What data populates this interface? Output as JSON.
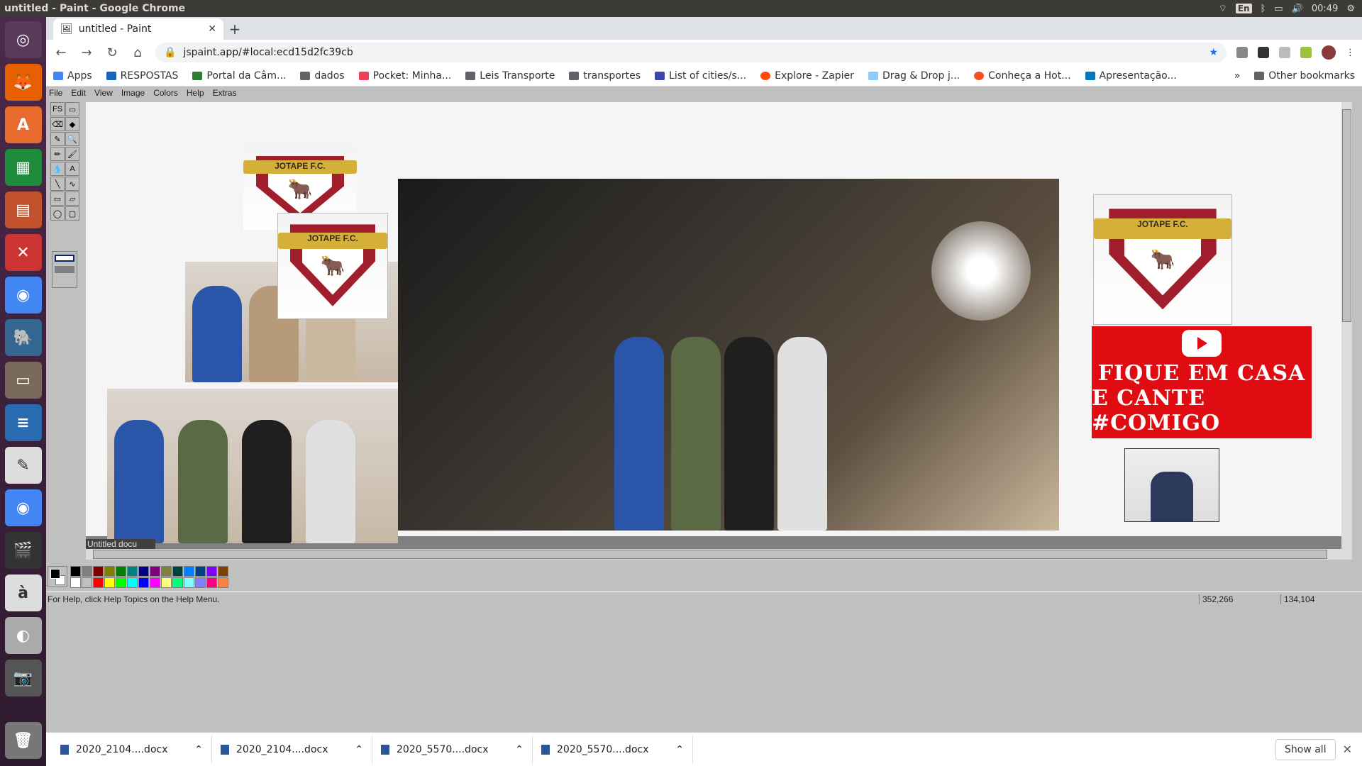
{
  "system": {
    "window_title": "untitled - Paint - Google Chrome",
    "language": "En",
    "time": "00:49"
  },
  "launcher": {
    "items": [
      "ubuntu-dash-icon",
      "firefox-icon",
      "software-center-icon",
      "calc-icon",
      "impress-icon",
      "settings-icon",
      "chrome-icon",
      "pgadmin-icon",
      "files-icon",
      "writer-icon",
      "text-editor-icon",
      "chrome-beta-icon",
      "video-editor-icon",
      "character-map-icon",
      "disk-icon",
      "webcam-icon",
      "trash-icon"
    ]
  },
  "browser": {
    "tab_title": "untitled - Paint",
    "url": "jspaint.app/#local:ecd15d2fc39cb",
    "bookmarks": [
      {
        "label": "Apps",
        "type": "apps"
      },
      {
        "label": "RESPOSTAS",
        "type": "site"
      },
      {
        "label": "Portal da Câm...",
        "type": "site"
      },
      {
        "label": "dados",
        "type": "folder"
      },
      {
        "label": "Pocket: Minha...",
        "type": "site"
      },
      {
        "label": "Leis Transporte",
        "type": "folder"
      },
      {
        "label": "transportes",
        "type": "folder"
      },
      {
        "label": "List of cities/s...",
        "type": "site"
      },
      {
        "label": "Explore - Zapier",
        "type": "site"
      },
      {
        "label": "Drag & Drop j...",
        "type": "site"
      },
      {
        "label": "Conheça a Hot...",
        "type": "site"
      },
      {
        "label": "Apresentação...",
        "type": "site"
      }
    ],
    "overflow_label": "»",
    "other_bookmarks": "Other bookmarks"
  },
  "paint": {
    "menu": [
      "File",
      "Edit",
      "View",
      "Image",
      "Colors",
      "Help",
      "Extras"
    ],
    "tools": [
      "FS",
      "▭",
      "⌫",
      "◆",
      "✎",
      "🔍",
      "✏",
      "🖌",
      "💧",
      "A",
      "╲",
      "∿",
      "▭",
      "▱",
      "◯",
      "▢"
    ],
    "document_label": "Untitled docu",
    "canvas": {
      "shield_text": "JOTAPE F.C.",
      "banner_line1": "FIQUE EM CASA",
      "banner_line2": "E CANTE #COMIGO"
    },
    "palette_colors": [
      "#000000",
      "#808080",
      "#800000",
      "#808000",
      "#008000",
      "#008080",
      "#000080",
      "#800080",
      "#808040",
      "#004040",
      "#0080ff",
      "#004080",
      "#8000ff",
      "#804000",
      "#ffffff",
      "#c0c0c0",
      "#ff0000",
      "#ffff00",
      "#00ff00",
      "#00ffff",
      "#0000ff",
      "#ff00ff",
      "#ffff80",
      "#00ff80",
      "#80ffff",
      "#8080ff",
      "#ff0080",
      "#ff8040"
    ],
    "foreground_color": "#000000",
    "background_color": "#ffffff",
    "status_help": "For Help, click Help Topics on the Help Menu.",
    "status_pos": "352,266",
    "status_size": "134,104"
  },
  "downloads": {
    "items": [
      "2020_2104....docx",
      "2020_2104....docx",
      "2020_5570....docx",
      "2020_5570....docx"
    ],
    "show_all": "Show all"
  }
}
